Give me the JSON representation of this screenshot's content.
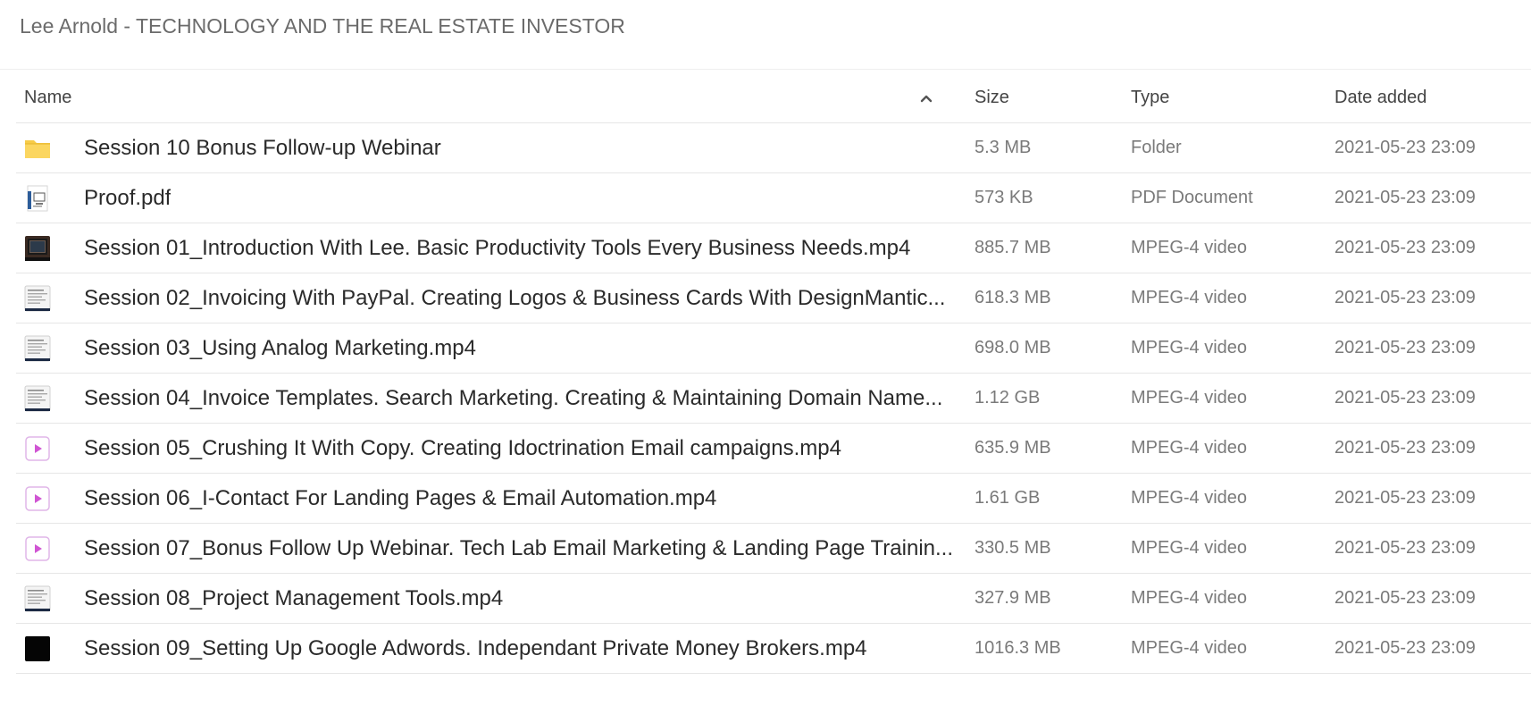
{
  "title": "Lee Arnold - TECHNOLOGY AND THE REAL ESTATE INVESTOR",
  "columns": {
    "name": "Name",
    "size": "Size",
    "type": "Type",
    "date": "Date added"
  },
  "sort": {
    "icon": "chevron-up-icon",
    "direction": "ascending"
  },
  "rows": [
    {
      "icon": "folder-icon",
      "name": "Session 10 Bonus Follow-up Webinar",
      "size": "5.3 MB",
      "type": "Folder",
      "date": "2021-05-23 23:09"
    },
    {
      "icon": "pdf-thumbnail-icon",
      "name": "Proof.pdf",
      "size": "573 KB",
      "type": "PDF Document",
      "date": "2021-05-23 23:09"
    },
    {
      "icon": "video-thumbnail-icon",
      "name": "Session 01_Introduction With Lee. Basic Productivity Tools Every Business Needs.mp4",
      "size": "885.7 MB",
      "type": "MPEG-4 video",
      "date": "2021-05-23 23:09"
    },
    {
      "icon": "video-thumbnail-icon",
      "name": "Session 02_Invoicing With PayPal. Creating Logos & Business Cards With DesignMantic...",
      "size": "618.3 MB",
      "type": "MPEG-4 video",
      "date": "2021-05-23 23:09"
    },
    {
      "icon": "video-thumbnail-icon",
      "name": "Session 03_Using Analog Marketing.mp4",
      "size": "698.0 MB",
      "type": "MPEG-4 video",
      "date": "2021-05-23 23:09"
    },
    {
      "icon": "video-thumbnail-icon",
      "name": "Session 04_Invoice Templates. Search Marketing. Creating & Maintaining Domain Name...",
      "size": "1.12 GB",
      "type": "MPEG-4 video",
      "date": "2021-05-23 23:09"
    },
    {
      "icon": "video-play-icon",
      "name": "Session 05_Crushing It With Copy. Creating Idoctrination Email campaigns.mp4",
      "size": "635.9 MB",
      "type": "MPEG-4 video",
      "date": "2021-05-23 23:09"
    },
    {
      "icon": "video-play-icon",
      "name": "Session 06_I-Contact For Landing Pages & Email Automation.mp4",
      "size": "1.61 GB",
      "type": "MPEG-4 video",
      "date": "2021-05-23 23:09"
    },
    {
      "icon": "video-play-icon",
      "name": "Session 07_Bonus Follow Up Webinar. Tech Lab Email Marketing & Landing Page Trainin...",
      "size": "330.5 MB",
      "type": "MPEG-4 video",
      "date": "2021-05-23 23:09"
    },
    {
      "icon": "video-thumbnail-icon",
      "name": "Session 08_Project Management Tools.mp4",
      "size": "327.9 MB",
      "type": "MPEG-4 video",
      "date": "2021-05-23 23:09"
    },
    {
      "icon": "video-thumbnail-black-icon",
      "name": "Session 09_Setting Up Google Adwords. Independant Private Money Brokers.mp4",
      "size": "1016.3 MB",
      "type": "MPEG-4 video",
      "date": "2021-05-23 23:09"
    }
  ]
}
